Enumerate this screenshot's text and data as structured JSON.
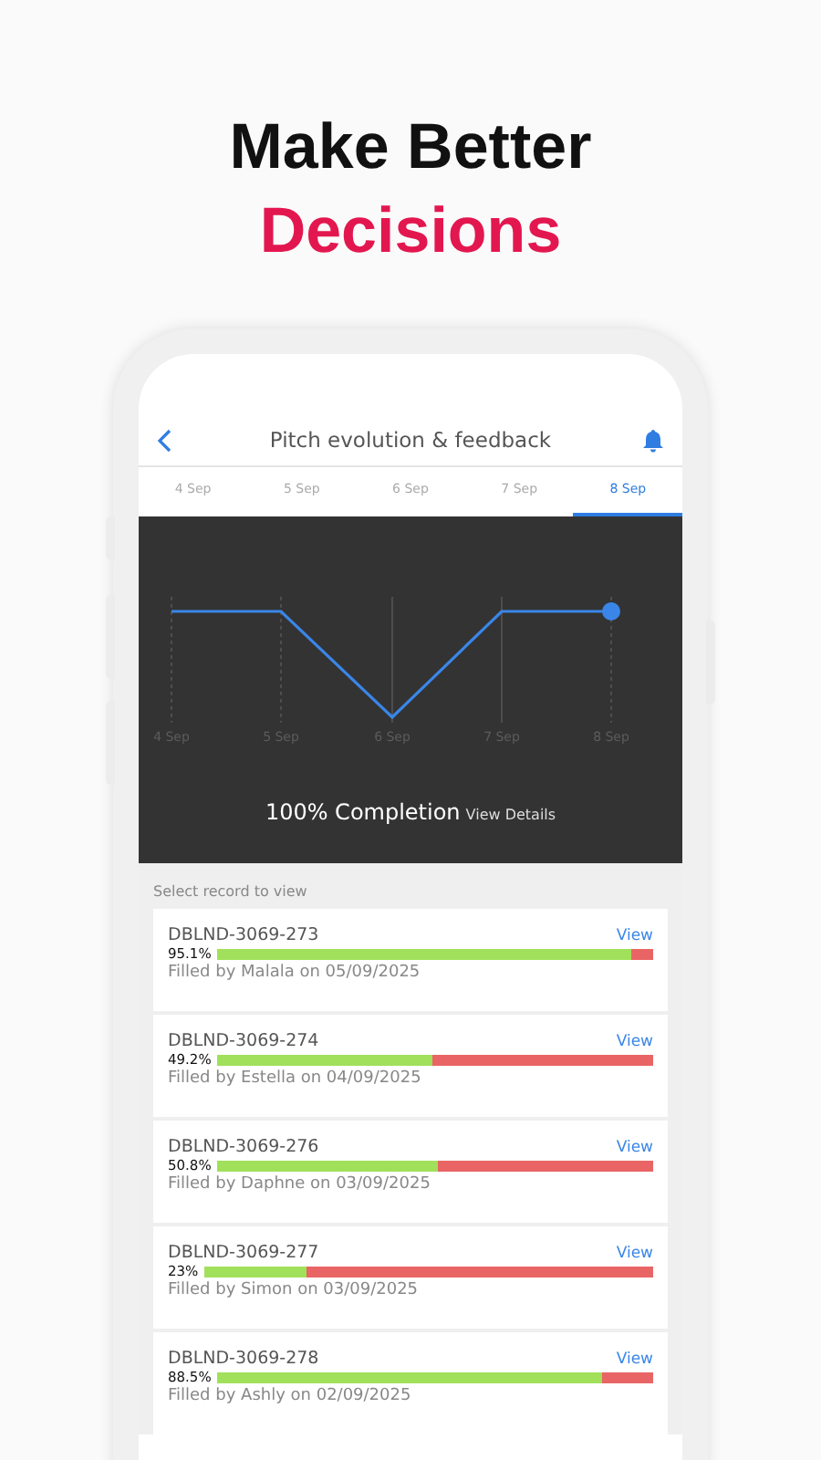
{
  "headline": {
    "line_1": "Make Better",
    "line_2": "Decisions"
  },
  "header": {
    "title": "Pitch evolution & feedback"
  },
  "tabs": [
    {
      "label": "4 Sep",
      "selected": false
    },
    {
      "label": "5 Sep",
      "selected": false
    },
    {
      "label": "6 Sep",
      "selected": false
    },
    {
      "label": "7 Sep",
      "selected": false
    },
    {
      "label": "8 Sep",
      "selected": true
    }
  ],
  "chart": {
    "x_labels": [
      "4 Sep",
      "5 Sep",
      "6 Sep",
      "7 Sep",
      "8 Sep"
    ],
    "completion": "100% Completion",
    "details_link": "View Details"
  },
  "list": {
    "caption": "Select record to view",
    "records": [
      {
        "code": "DBLND-3069-273",
        "percent": "95.1%",
        "level": 0.951,
        "filled_by": "Filled by Malala on 05/09/2025",
        "action": "View"
      },
      {
        "code": "DBLND-3069-274",
        "percent": "49.2%",
        "level": 0.492,
        "filled_by": "Filled by Estella on 04/09/2025",
        "action": "View"
      },
      {
        "code": "DBLND-3069-276",
        "percent": "50.8%",
        "level": 0.508,
        "filled_by": "Filled by Daphne on 03/09/2025",
        "action": "View"
      },
      {
        "code": "DBLND-3069-277",
        "percent": "23%",
        "level": 0.23,
        "filled_by": "Filled by Simon on 03/09/2025",
        "action": "View"
      },
      {
        "code": "DBLND-3069-278",
        "percent": "88.5%",
        "level": 0.885,
        "filled_by": "Filled by Ashly on 02/09/2025",
        "action": "View"
      }
    ]
  }
}
